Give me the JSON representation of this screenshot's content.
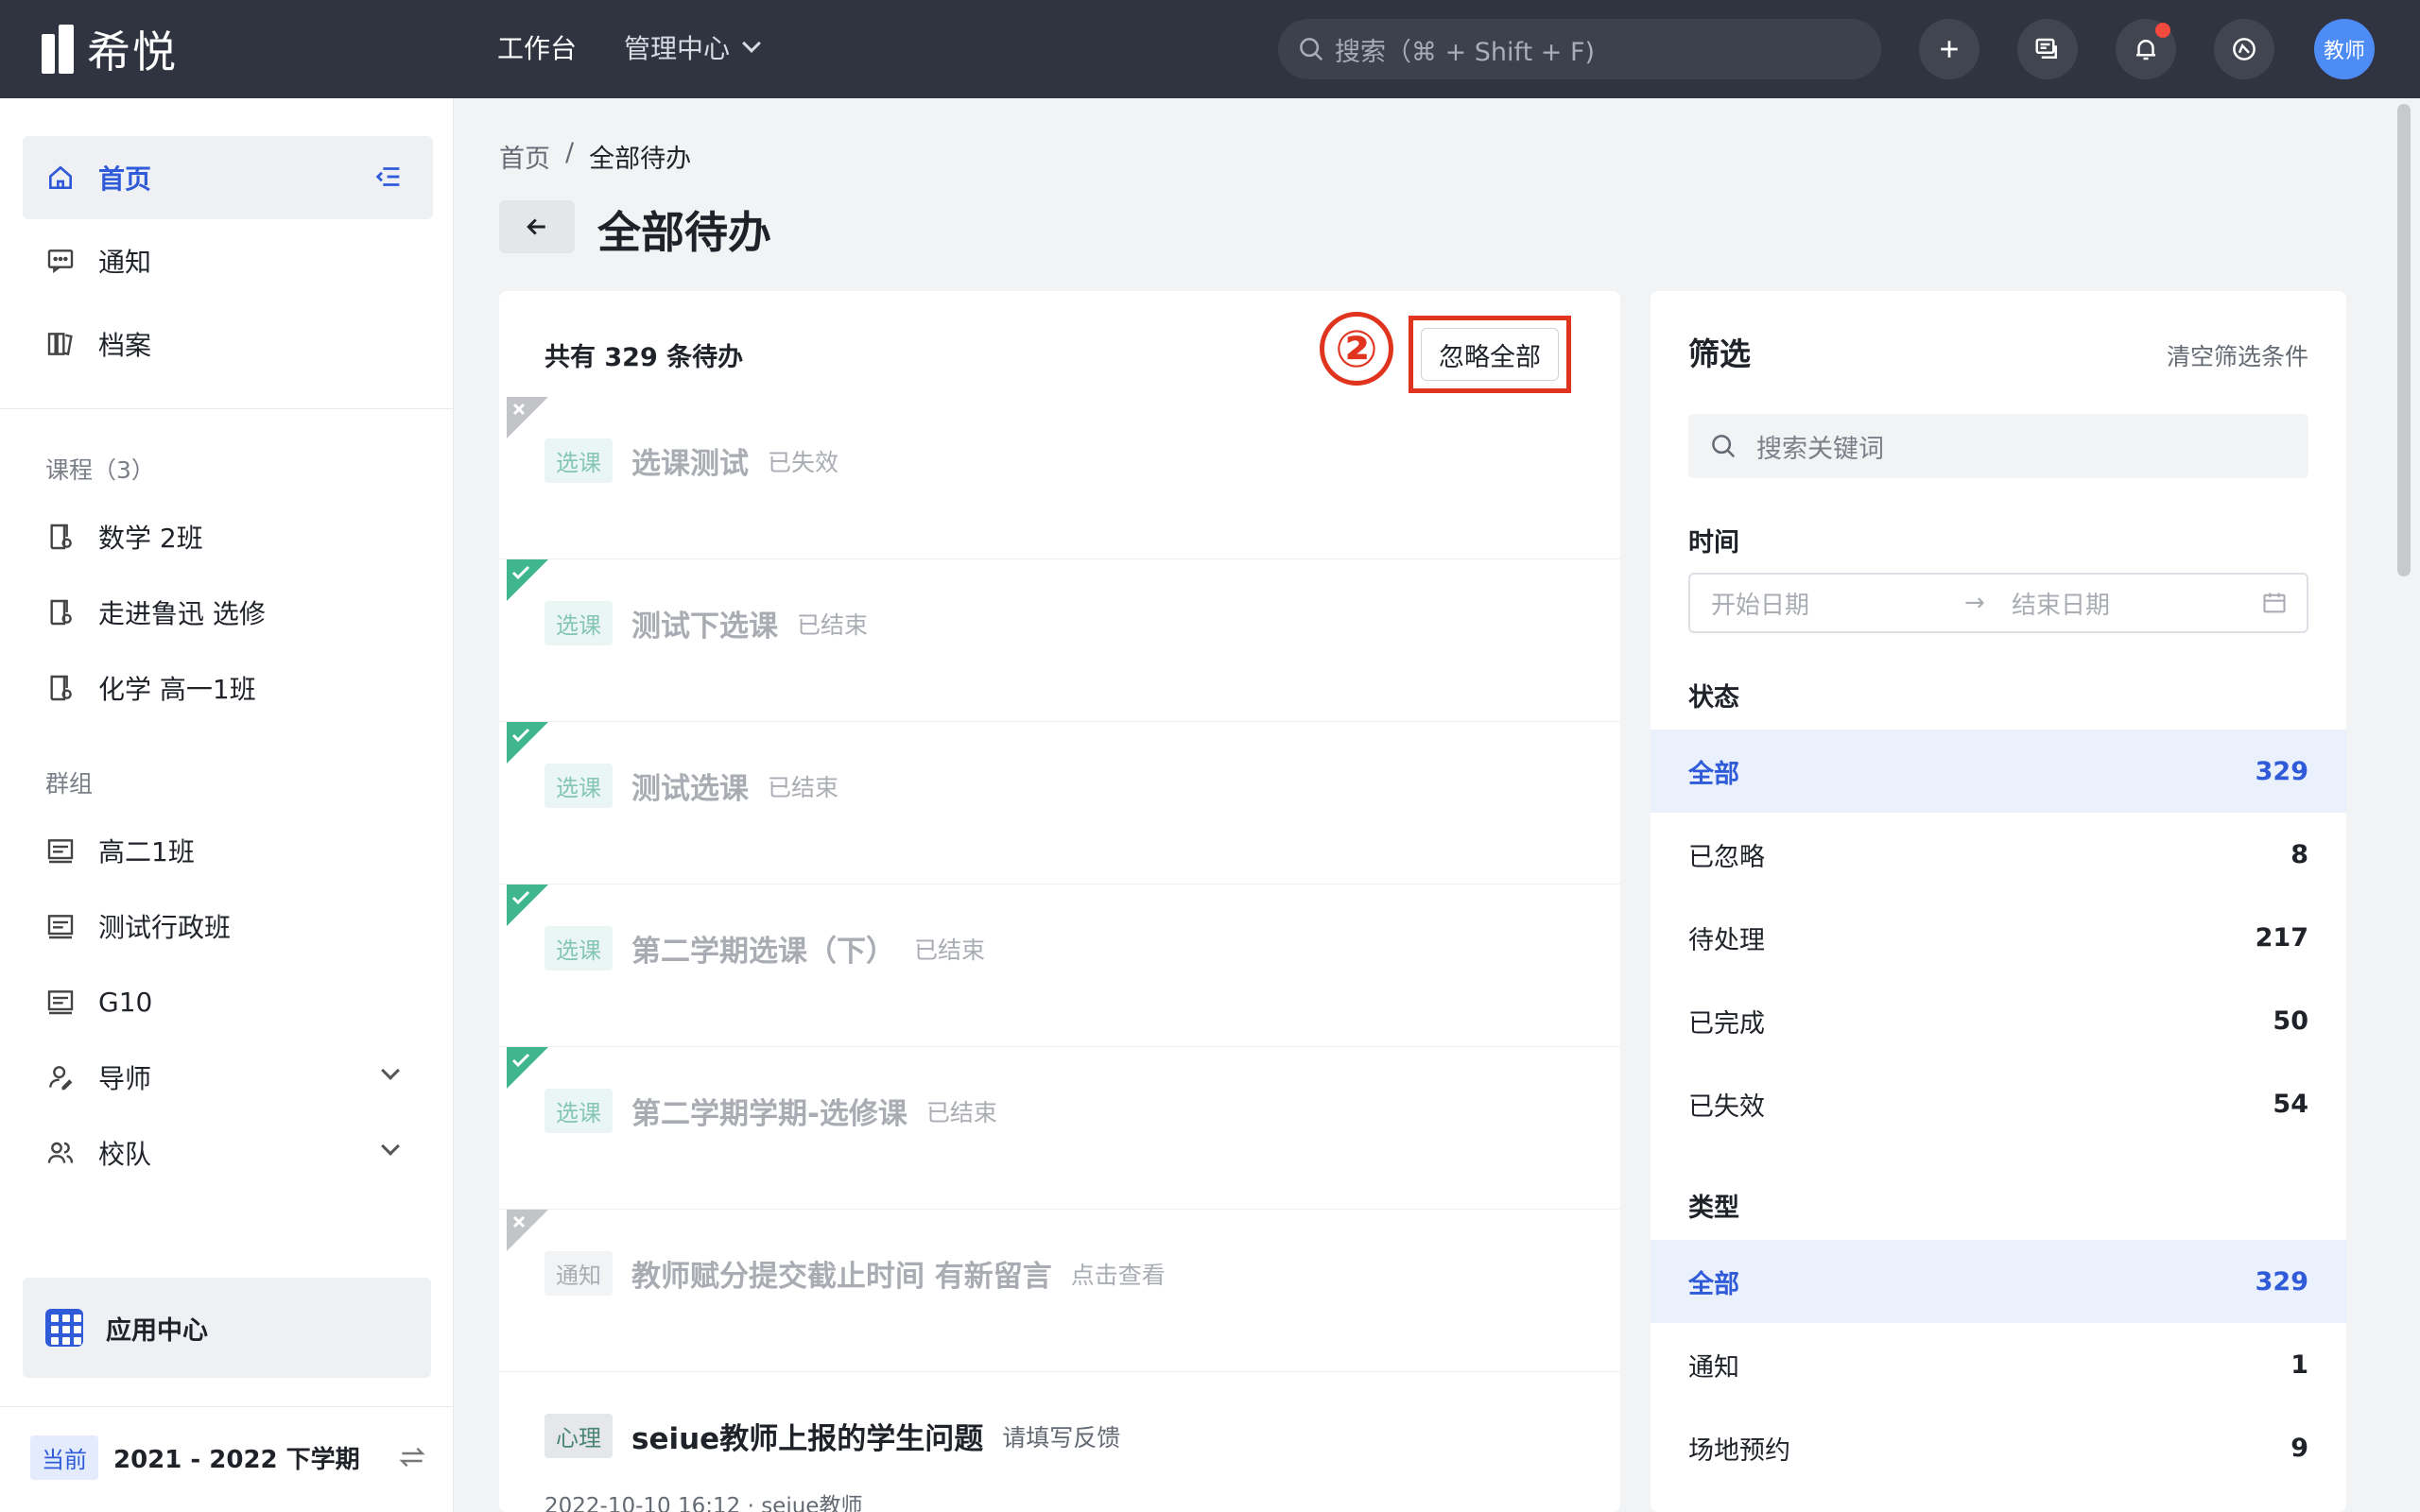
{
  "topbar": {
    "logo_text": "希悦",
    "nav": [
      {
        "label": "工作台"
      },
      {
        "label": "管理中心"
      }
    ],
    "search_placeholder": "搜索（⌘ + Shift + F)",
    "avatar_label": "教师",
    "colors": {
      "bar": "#2f3440",
      "avatar": "#4d8cf5",
      "notification_dot": "#f5493d"
    }
  },
  "sidebar": {
    "top_items": [
      {
        "label": "首页",
        "icon": "home-icon",
        "active": true
      },
      {
        "label": "通知",
        "icon": "message-icon"
      },
      {
        "label": "档案",
        "icon": "archive-icon"
      }
    ],
    "courses_label": "课程（3）",
    "courses": [
      {
        "label": "数学 2班",
        "icon": "course-icon"
      },
      {
        "label": "走进鲁迅 选修",
        "icon": "course-icon"
      },
      {
        "label": "化学 高一1班",
        "icon": "course-icon"
      }
    ],
    "groups_label": "群组",
    "groups": [
      {
        "label": "高二1班",
        "icon": "class-icon"
      },
      {
        "label": "测试行政班",
        "icon": "class-icon"
      },
      {
        "label": "G10",
        "icon": "class-icon"
      },
      {
        "label": "导师",
        "icon": "mentor-icon"
      },
      {
        "label": "校队",
        "icon": "team-icon"
      }
    ],
    "app_center_label": "应用中心",
    "semester_tag": "当前",
    "semester_label": "2021 - 2022 下学期"
  },
  "main": {
    "breadcrumb": {
      "home": "首页",
      "sep": "/",
      "current": "全部待办"
    },
    "page_title": "全部待办",
    "todo_count_label": "共有 329 条待办",
    "ignore_all_label": "忽略全部",
    "annotation_label": "②",
    "todos": [
      {
        "tag": "选课",
        "title": "选课测试",
        "status": "已失效",
        "corner": "x"
      },
      {
        "tag": "选课",
        "title": "测试下选课",
        "status": "已结束",
        "corner": "check"
      },
      {
        "tag": "选课",
        "title": "测试选课",
        "status": "已结束",
        "corner": "check"
      },
      {
        "tag": "选课",
        "title": "第二学期选课（下）",
        "status": "已结束",
        "corner": "check"
      },
      {
        "tag": "选课",
        "title": "第二学期学期-选修课",
        "status": "已结束",
        "corner": "check"
      },
      {
        "tag": "通知",
        "title": "教师赋分提交截止时间 有新留言",
        "status": "点击查看",
        "corner": "x"
      },
      {
        "tag": "心理",
        "title": "seiue教师上报的学生问题",
        "status": "请填写反馈",
        "corner": "none",
        "meta": "2022-10-10 16:12  ·  seiue教师"
      }
    ]
  },
  "filter": {
    "title": "筛选",
    "clear_label": "清空筛选条件",
    "search_placeholder": "搜索关键词",
    "time_label": "时间",
    "start_placeholder": "开始日期",
    "end_placeholder": "结束日期",
    "status_label": "状态",
    "status_options": [
      {
        "label": "全部",
        "count": "329",
        "selected": true
      },
      {
        "label": "已忽略",
        "count": "8"
      },
      {
        "label": "待处理",
        "count": "217"
      },
      {
        "label": "已完成",
        "count": "50"
      },
      {
        "label": "已失效",
        "count": "54"
      }
    ],
    "type_label": "类型",
    "type_options": [
      {
        "label": "全部",
        "count": "329",
        "selected": true
      },
      {
        "label": "通知",
        "count": "1"
      },
      {
        "label": "场地预约",
        "count": "9"
      }
    ]
  }
}
